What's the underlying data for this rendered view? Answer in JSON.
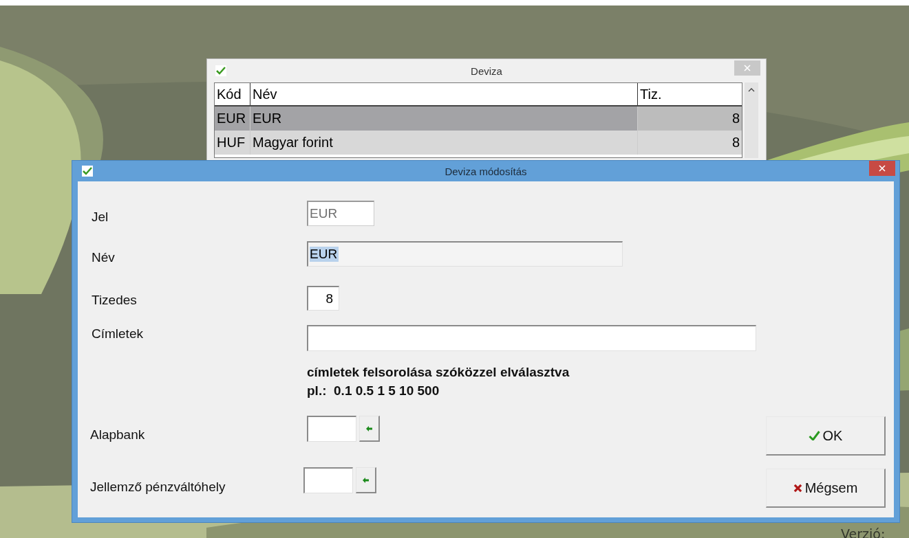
{
  "desktop": {
    "version_label": "Verzió:"
  },
  "back_window": {
    "title": "Deviza",
    "table": {
      "columns": [
        "Kód",
        "Név",
        "Tiz."
      ],
      "rows": [
        {
          "cells": [
            "EUR",
            "EUR",
            "8"
          ],
          "selected": true
        },
        {
          "cells": [
            "HUF",
            "Magyar forint",
            "8"
          ],
          "selected": false
        }
      ]
    }
  },
  "dialog": {
    "title": "Deviza módosítás",
    "fields": [
      {
        "kind": "text",
        "label": "Jel",
        "value": "EUR",
        "disabled": true,
        "text_selected": false
      },
      {
        "kind": "text",
        "label": "Név",
        "value": "EUR",
        "disabled": false,
        "text_selected": true
      },
      {
        "kind": "number",
        "label": "Tizedes",
        "value": "8",
        "disabled": false,
        "text_selected": false
      },
      {
        "kind": "wide",
        "label": "Címletek",
        "disabled": false
      },
      {
        "kind": "hint",
        "lines": [
          "címletek felsorolása szóközzel elválasztva",
          "pl.:  0.1 0.5 1 5 10 500"
        ]
      },
      {
        "kind": "lookup",
        "label": "Alapbank",
        "disabled": false
      },
      {
        "kind": "lookup",
        "label": "Jellemző pénzváltóhely",
        "disabled": false
      }
    ],
    "buttons": [
      {
        "kind": "ok",
        "label": "OK"
      },
      {
        "kind": "cancel",
        "label": "Mégsem"
      }
    ]
  }
}
